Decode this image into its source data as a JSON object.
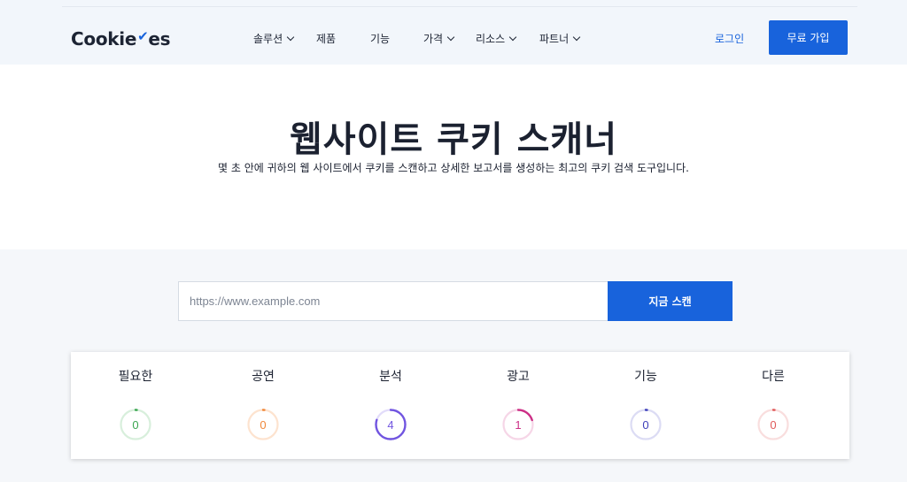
{
  "header": {
    "logo_text": "Cookie",
    "logo_accent": "✔",
    "logo_suffix": "es",
    "nav": [
      {
        "label": "솔루션",
        "dropdown": true
      },
      {
        "label": "제품",
        "dropdown": false
      },
      {
        "label": "기능",
        "dropdown": false
      },
      {
        "label": "가격",
        "dropdown": true
      },
      {
        "label": "리소스",
        "dropdown": true
      },
      {
        "label": "파트너",
        "dropdown": true
      }
    ],
    "login_label": "로그인",
    "signup_label": "무료 가입"
  },
  "hero": {
    "title": "웹사이트 쿠키 스캐너",
    "subtitle": "몇 초 안에 귀하의 웹 사이트에서 쿠키를 스캔하고 상세한 보고서를 생성하는 최고의 쿠키 검색 도구입니다."
  },
  "scan": {
    "placeholder": "https://www.example.com",
    "value": "",
    "button_label": "지금 스캔"
  },
  "categories": [
    {
      "label": "필요한",
      "count": "0",
      "progress": 0,
      "color": "#3aa650",
      "track": "#d8efdc"
    },
    {
      "label": "공연",
      "count": "0",
      "progress": 0,
      "color": "#f0883a",
      "track": "#fde3cf"
    },
    {
      "label": "분석",
      "count": "4",
      "progress": 0.8,
      "color": "#7155e0",
      "track": "#e2dcfa"
    },
    {
      "label": "광고",
      "count": "1",
      "progress": 0.2,
      "color": "#cc2f86",
      "track": "#f6d6e7"
    },
    {
      "label": "기능",
      "count": "0",
      "progress": 0,
      "color": "#3d3fba",
      "track": "#dcdcf4"
    },
    {
      "label": "다른",
      "count": "0",
      "progress": 0,
      "color": "#e05a5a",
      "track": "#f9dede"
    }
  ],
  "colors": {
    "brand": "#1863dc",
    "text": "#1b2130"
  },
  "icons": {
    "dropdown": "chevron-down-icon"
  }
}
